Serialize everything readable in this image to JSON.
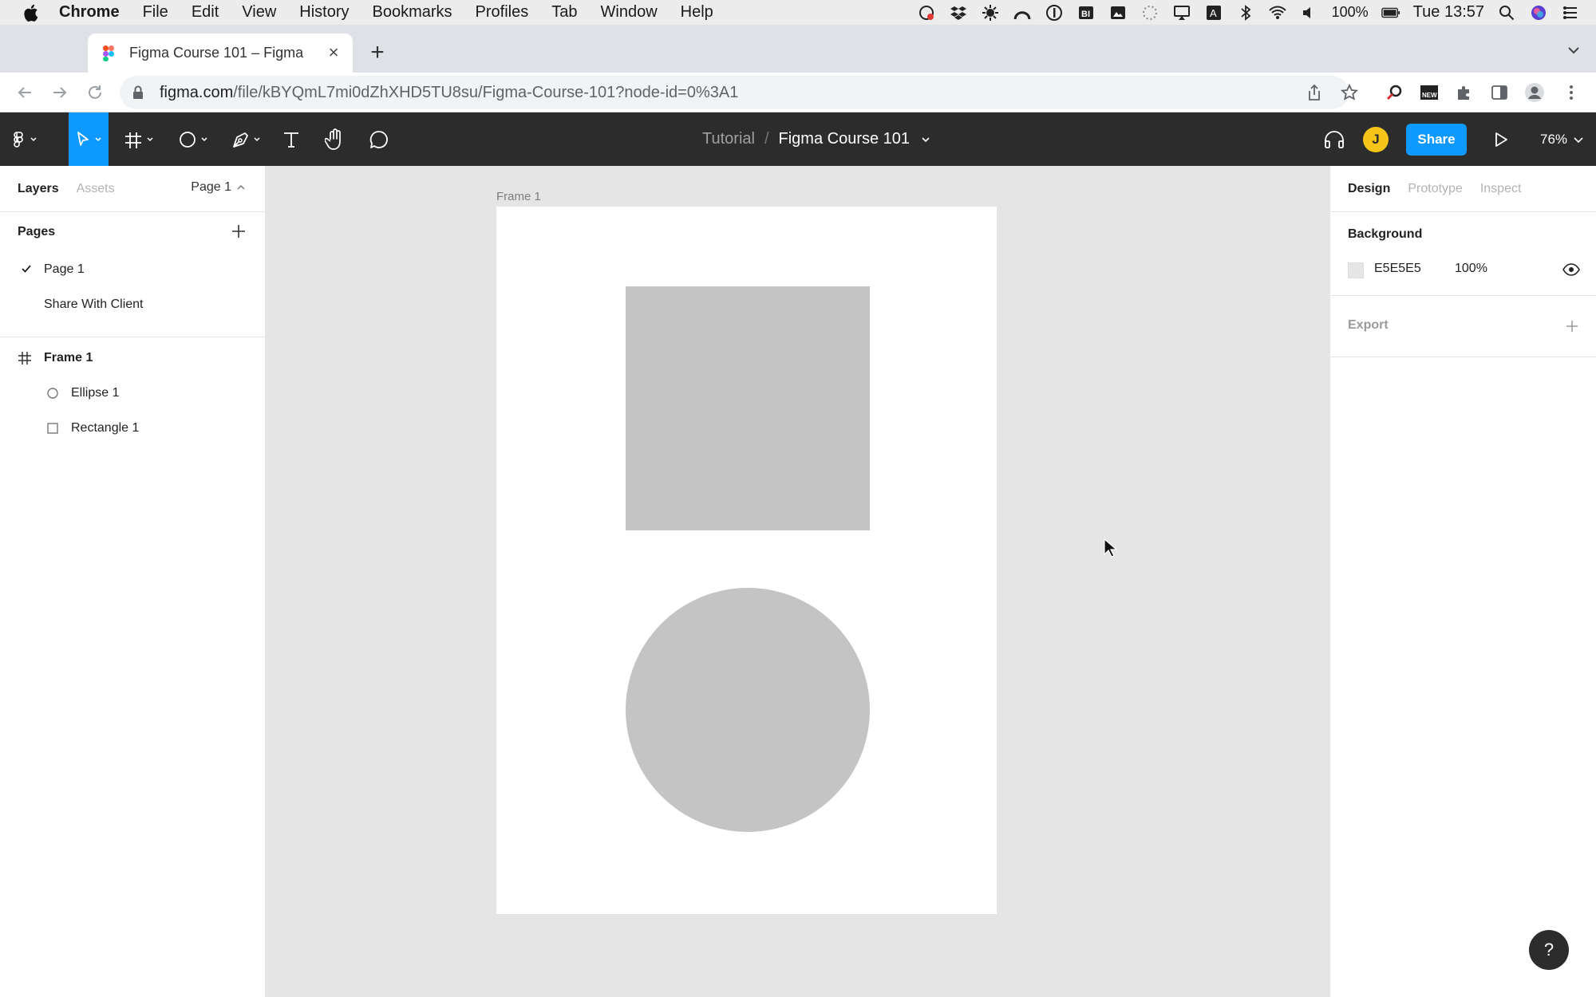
{
  "menubar": {
    "app": "Chrome",
    "items": [
      "File",
      "Edit",
      "View",
      "History",
      "Bookmarks",
      "Profiles",
      "Tab",
      "Window",
      "Help"
    ],
    "battery": "100%",
    "clock": "Tue 13:57"
  },
  "browser": {
    "tab_title": "Figma Course 101 – Figma",
    "url_host": "figma.com",
    "url_path": "/file/kBYQmL7mi0dZhXHD5TU8su/Figma-Course-101?node-id=0%3A1"
  },
  "toolbar": {
    "team": "Tutorial",
    "separator": "/",
    "file_name": "Figma Course 101",
    "avatar_initial": "J",
    "share_label": "Share",
    "zoom": "76%"
  },
  "left_panel": {
    "tabs": [
      "Layers",
      "Assets"
    ],
    "current_page_select": "Page 1",
    "pages_heading": "Pages",
    "pages": [
      "Page 1",
      "Share With Client"
    ],
    "layers": [
      {
        "name": "Frame 1",
        "type": "frame-icon"
      },
      {
        "name": "Ellipse 1",
        "type": "ellipse-icon"
      },
      {
        "name": "Rectangle 1",
        "type": "rectangle-icon"
      }
    ]
  },
  "canvas": {
    "frame_label": "Frame 1",
    "shape_fill": "#C4C4C4",
    "background": "#E5E5E5"
  },
  "right_panel": {
    "tabs": [
      "Design",
      "Prototype",
      "Inspect"
    ],
    "background_heading": "Background",
    "background_hex": "E5E5E5",
    "background_opacity": "100%",
    "export_label": "Export"
  },
  "help_label": "?"
}
